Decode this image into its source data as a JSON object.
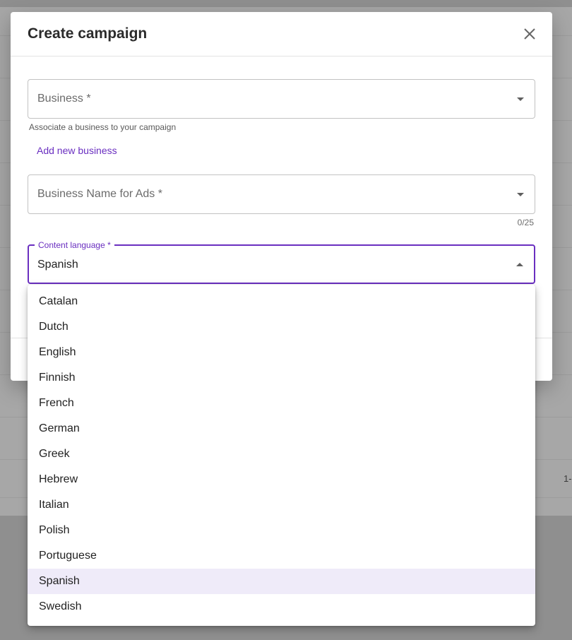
{
  "background": {
    "page_text": "1-"
  },
  "modal": {
    "title": "Create campaign",
    "business_field": {
      "label": "Business *",
      "helper": "Associate a business to your campaign",
      "add_link": "Add new business"
    },
    "business_name_field": {
      "label": "Business Name for Ads *",
      "counter": "0/25"
    },
    "language_field": {
      "label": "Content language *",
      "value": "Spanish"
    }
  },
  "dropdown": {
    "options": [
      "Catalan",
      "Dutch",
      "English",
      "Finnish",
      "French",
      "German",
      "Greek",
      "Hebrew",
      "Italian",
      "Polish",
      "Portuguese",
      "Spanish",
      "Swedish"
    ],
    "selected": "Spanish"
  },
  "colors": {
    "accent": "#6a2fc0",
    "selected_bg": "#efebf9"
  }
}
